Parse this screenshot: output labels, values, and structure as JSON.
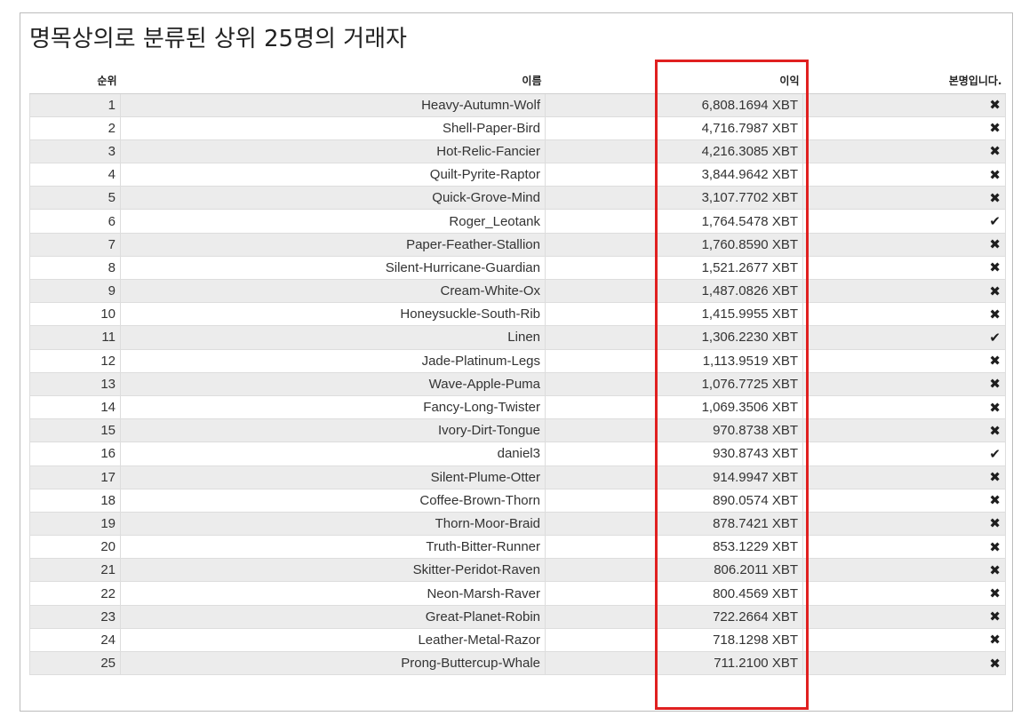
{
  "title": "명목상의로 분류된 상위 25명의 거래자",
  "columns": {
    "rank": "순위",
    "name": "이름",
    "profit": "이익",
    "verified": "본명입니다."
  },
  "icons": {
    "yes": "✔",
    "no": "✖"
  },
  "highlight_color": "#e02020",
  "rows": [
    {
      "rank": "1",
      "name": "Heavy-Autumn-Wolf",
      "profit": "6,808.1694 XBT",
      "verified": false
    },
    {
      "rank": "2",
      "name": "Shell-Paper-Bird",
      "profit": "4,716.7987 XBT",
      "verified": false
    },
    {
      "rank": "3",
      "name": "Hot-Relic-Fancier",
      "profit": "4,216.3085 XBT",
      "verified": false
    },
    {
      "rank": "4",
      "name": "Quilt-Pyrite-Raptor",
      "profit": "3,844.9642 XBT",
      "verified": false
    },
    {
      "rank": "5",
      "name": "Quick-Grove-Mind",
      "profit": "3,107.7702 XBT",
      "verified": false
    },
    {
      "rank": "6",
      "name": "Roger_Leotank",
      "profit": "1,764.5478 XBT",
      "verified": true
    },
    {
      "rank": "7",
      "name": "Paper-Feather-Stallion",
      "profit": "1,760.8590 XBT",
      "verified": false
    },
    {
      "rank": "8",
      "name": "Silent-Hurricane-Guardian",
      "profit": "1,521.2677 XBT",
      "verified": false
    },
    {
      "rank": "9",
      "name": "Cream-White-Ox",
      "profit": "1,487.0826 XBT",
      "verified": false
    },
    {
      "rank": "10",
      "name": "Honeysuckle-South-Rib",
      "profit": "1,415.9955 XBT",
      "verified": false
    },
    {
      "rank": "11",
      "name": "Linen",
      "profit": "1,306.2230 XBT",
      "verified": true
    },
    {
      "rank": "12",
      "name": "Jade-Platinum-Legs",
      "profit": "1,113.9519 XBT",
      "verified": false
    },
    {
      "rank": "13",
      "name": "Wave-Apple-Puma",
      "profit": "1,076.7725 XBT",
      "verified": false
    },
    {
      "rank": "14",
      "name": "Fancy-Long-Twister",
      "profit": "1,069.3506 XBT",
      "verified": false
    },
    {
      "rank": "15",
      "name": "Ivory-Dirt-Tongue",
      "profit": "970.8738 XBT",
      "verified": false
    },
    {
      "rank": "16",
      "name": "daniel3",
      "profit": "930.8743 XBT",
      "verified": true
    },
    {
      "rank": "17",
      "name": "Silent-Plume-Otter",
      "profit": "914.9947 XBT",
      "verified": false
    },
    {
      "rank": "18",
      "name": "Coffee-Brown-Thorn",
      "profit": "890.0574 XBT",
      "verified": false
    },
    {
      "rank": "19",
      "name": "Thorn-Moor-Braid",
      "profit": "878.7421 XBT",
      "verified": false
    },
    {
      "rank": "20",
      "name": "Truth-Bitter-Runner",
      "profit": "853.1229 XBT",
      "verified": false
    },
    {
      "rank": "21",
      "name": "Skitter-Peridot-Raven",
      "profit": "806.2011 XBT",
      "verified": false
    },
    {
      "rank": "22",
      "name": "Neon-Marsh-Raver",
      "profit": "800.4569 XBT",
      "verified": false
    },
    {
      "rank": "23",
      "name": "Great-Planet-Robin",
      "profit": "722.2664 XBT",
      "verified": false
    },
    {
      "rank": "24",
      "name": "Leather-Metal-Razor",
      "profit": "718.1298 XBT",
      "verified": false
    },
    {
      "rank": "25",
      "name": "Prong-Buttercup-Whale",
      "profit": "711.2100 XBT",
      "verified": false
    }
  ]
}
